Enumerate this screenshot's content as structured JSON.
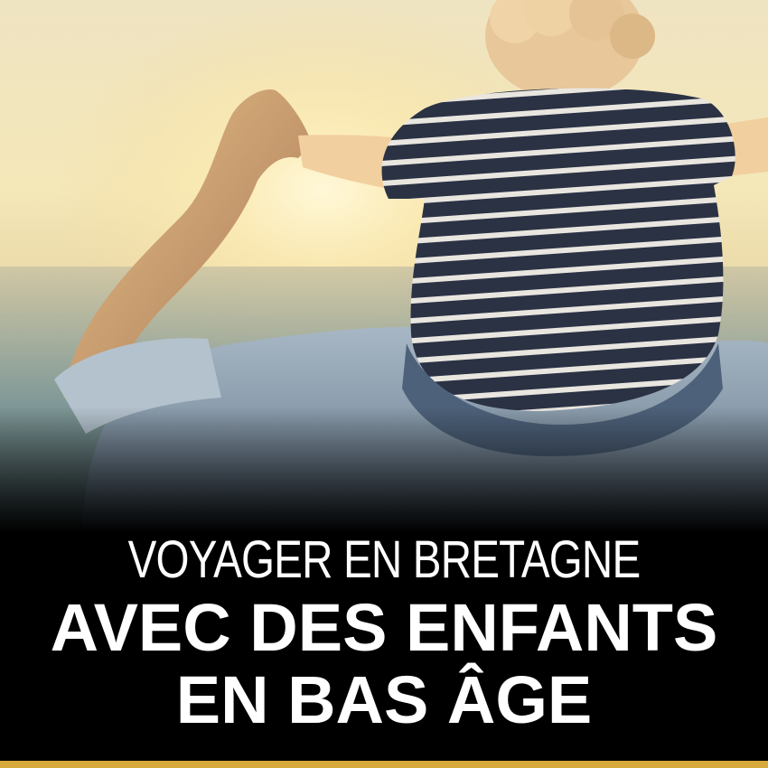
{
  "title": {
    "line1": "VOYAGER EN BRETAGNE",
    "line2": "AVEC DES ENFANTS",
    "line3": "EN BAS ÂGE"
  },
  "colors": {
    "accent_bar": "#d6a93a",
    "title_text": "#ffffff",
    "banner_background": "#000000"
  }
}
